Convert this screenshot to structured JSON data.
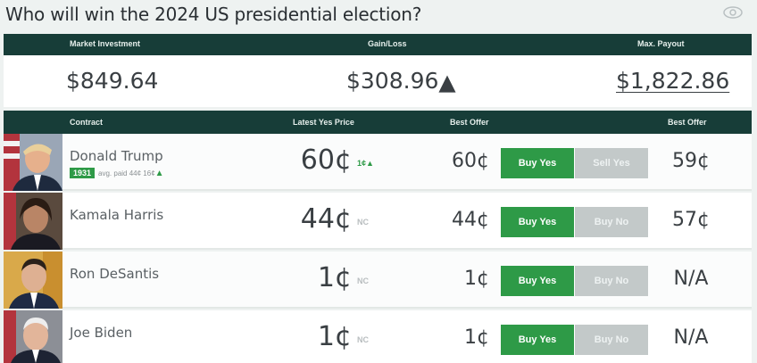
{
  "title": "Who will win the 2024 US presidential election?",
  "icons": {
    "eye": "eye-icon"
  },
  "summary": {
    "headers": {
      "investment": "Market Investment",
      "gain": "Gain/Loss",
      "payout": "Max. Payout"
    },
    "investment": "$849.64",
    "gain": "$308.96",
    "gain_indicator": "▲",
    "payout": "$1,822.86"
  },
  "table_headers": {
    "contract": "Contract",
    "latest": "Latest Yes Price",
    "best_offer_1": "Best Offer",
    "best_offer_2": "Best Offer"
  },
  "rows": [
    {
      "name": "Donald Trump",
      "badge": "1931",
      "avg": "avg. paid 44¢ 16¢",
      "avg_indicator": "▲",
      "price": "60¢",
      "change": "1¢",
      "change_indicator": "▲",
      "offer_yes": "60¢",
      "btn_yes": "Buy Yes",
      "btn_second": "Sell Yes",
      "offer_no": "59¢"
    },
    {
      "name": "Kamala Harris",
      "price": "44¢",
      "change": "NC",
      "offer_yes": "44¢",
      "btn_yes": "Buy Yes",
      "btn_second": "Buy No",
      "offer_no": "57¢"
    },
    {
      "name": "Ron DeSantis",
      "price": "1¢",
      "change": "NC",
      "offer_yes": "1¢",
      "btn_yes": "Buy Yes",
      "btn_second": "Buy No",
      "offer_no": "N/A"
    },
    {
      "name": "Joe Biden",
      "price": "1¢",
      "change": "NC",
      "offer_yes": "1¢",
      "btn_yes": "Buy Yes",
      "btn_second": "Buy No",
      "offer_no": "N/A"
    }
  ],
  "colors": {
    "header_bg": "#173d38",
    "accent_green": "#2e9a47",
    "disabled_btn": "#c3c9c9"
  }
}
